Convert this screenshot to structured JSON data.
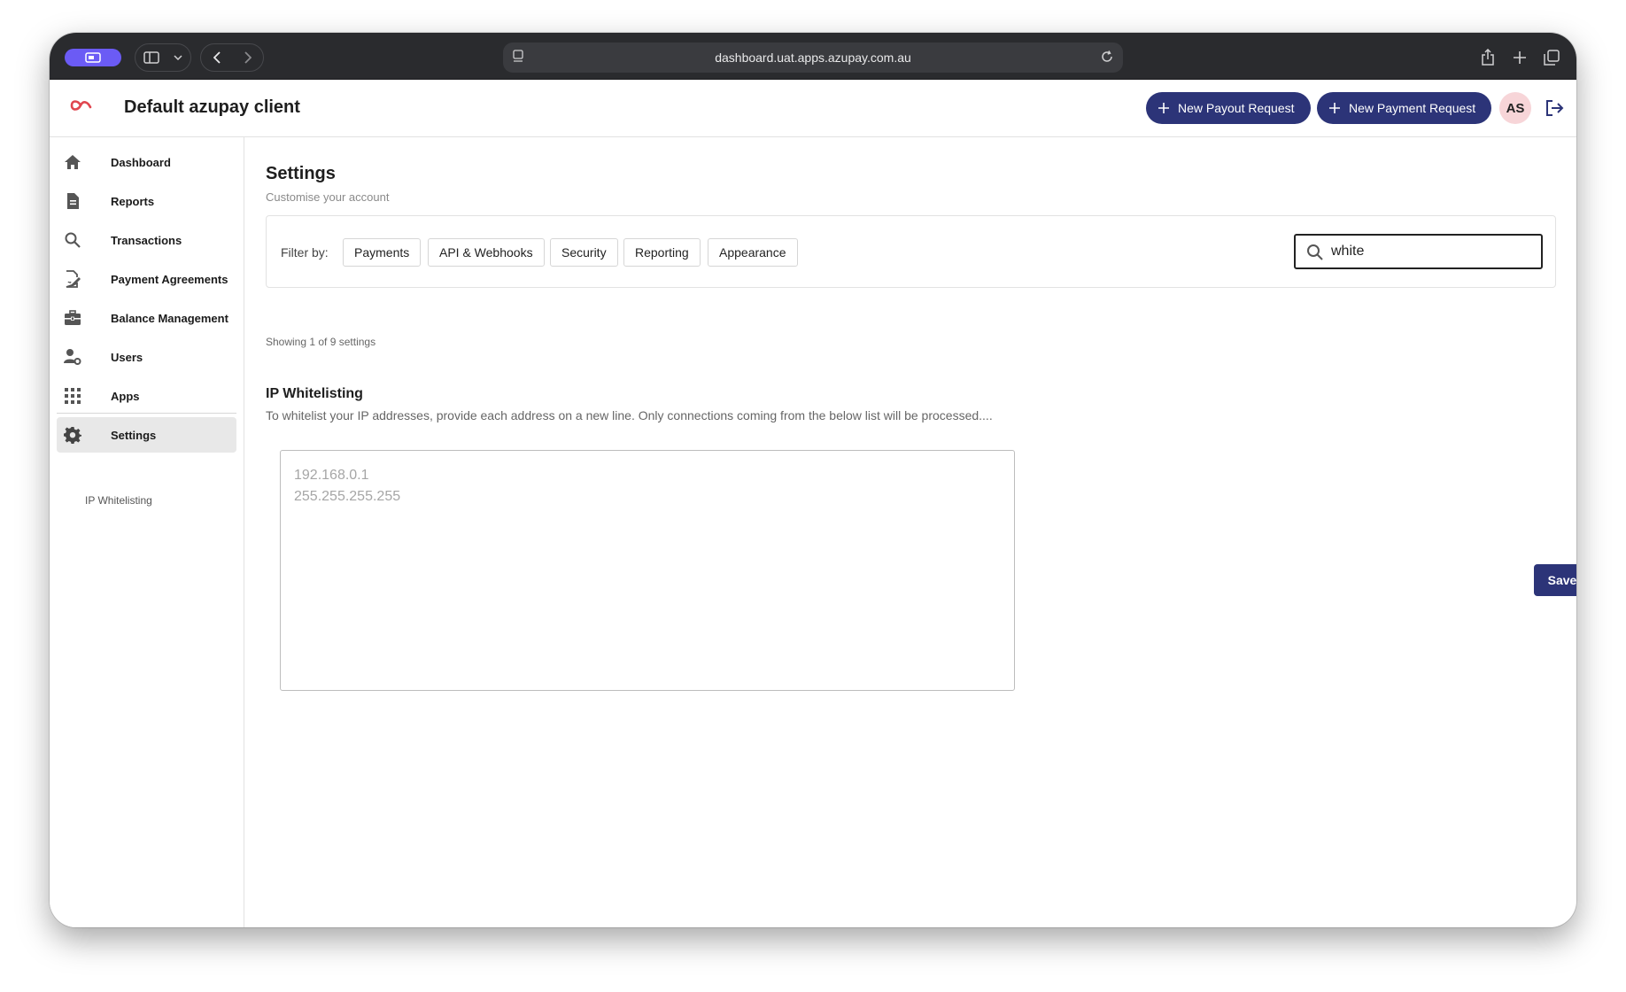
{
  "browser": {
    "url": "dashboard.uat.apps.azupay.com.au"
  },
  "header": {
    "client_name": "Default azupay client",
    "new_payout_label": "New Payout Request",
    "new_payment_label": "New Payment Request",
    "avatar_initials": "AS"
  },
  "sidebar": {
    "items": [
      {
        "label": "Dashboard",
        "icon": "home-icon"
      },
      {
        "label": "Reports",
        "icon": "document-icon"
      },
      {
        "label": "Transactions",
        "icon": "search-icon"
      },
      {
        "label": "Payment Agreements",
        "icon": "signature-icon"
      },
      {
        "label": "Balance Management",
        "icon": "briefcase-icon"
      },
      {
        "label": "Users",
        "icon": "user-gear-icon"
      },
      {
        "label": "Apps",
        "icon": "grid-icon"
      },
      {
        "label": "Settings",
        "icon": "gear-icon"
      }
    ],
    "sub_item": "IP Whitelisting"
  },
  "main": {
    "title": "Settings",
    "subtitle": "Customise your account",
    "filter_label": "Filter by:",
    "filters": [
      "Payments",
      "API & Webhooks",
      "Security",
      "Reporting",
      "Appearance"
    ],
    "search_value": "white",
    "count_text": "Showing 1 of 9 settings",
    "section": {
      "title": "IP Whitelisting",
      "description": "To whitelist your IP addresses, provide each address on a new line. Only connections coming from the below list will be processed....",
      "placeholder": "192.168.0.1\n255.255.255.255",
      "save_label": "Save"
    }
  },
  "colors": {
    "primary": "#2c3478",
    "brand_logo": "#e0464f",
    "avatar_bg": "#f7d5d8",
    "chrome_bg": "#2a2b2e"
  }
}
